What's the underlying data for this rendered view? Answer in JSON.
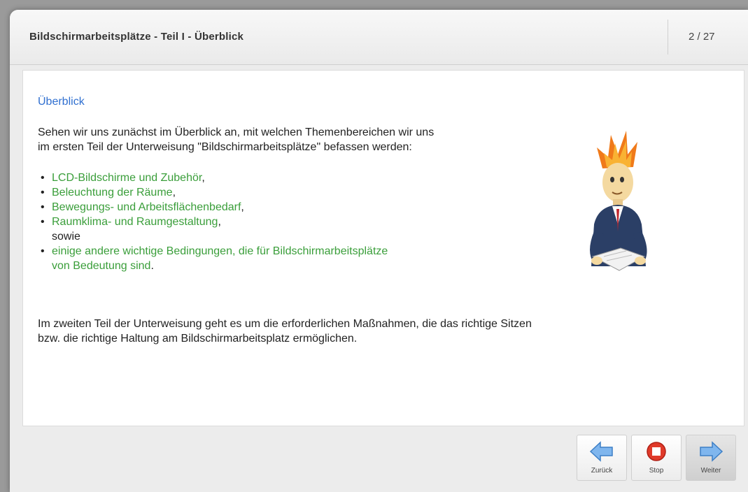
{
  "header": {
    "title": "Bildschirmarbeitsplätze - Teil I - Überblick",
    "page_counter": "2 / 27"
  },
  "content": {
    "section_title": "Überblick",
    "intro_line1": "Sehen wir uns zunächst im Überblick an, mit welchen Themenbereichen wir uns",
    "intro_line2": "im ersten Teil der Unterweisung \"Bildschirmarbeitsplätze\" befassen werden:",
    "topics": [
      {
        "text": "LCD-Bildschirme und Zubehör",
        "suffix": ","
      },
      {
        "text": "Beleuchtung der Räume",
        "suffix": ","
      },
      {
        "text": "Bewegungs- und Arbeitsflächenbedarf",
        "suffix": ","
      },
      {
        "text": "Raumklima- und Raumgestaltung",
        "suffix": ","
      }
    ],
    "connector": "sowie",
    "last_topic_line1": "einige andere wichtige Bedingungen, die für Bildschirmarbeitsplätze",
    "last_topic_line2": "von Bedeutung sind",
    "last_topic_suffix": ".",
    "outro_line1": "Im zweiten Teil der Unterweisung geht es um die erforderlichen Maßnahmen, die das richtige Sitzen",
    "outro_line2": "bzw. die richtige Haltung am Bildschirmarbeitsplatz ermöglichen."
  },
  "footer": {
    "back_label": "Zurück",
    "stop_label": "Stop",
    "next_label": "Weiter"
  },
  "colors": {
    "link_blue": "#2f6fd0",
    "topic_green": "#3a9e3a",
    "nav_blue": "#5a9ee6",
    "stop_red": "#e03a2a"
  }
}
